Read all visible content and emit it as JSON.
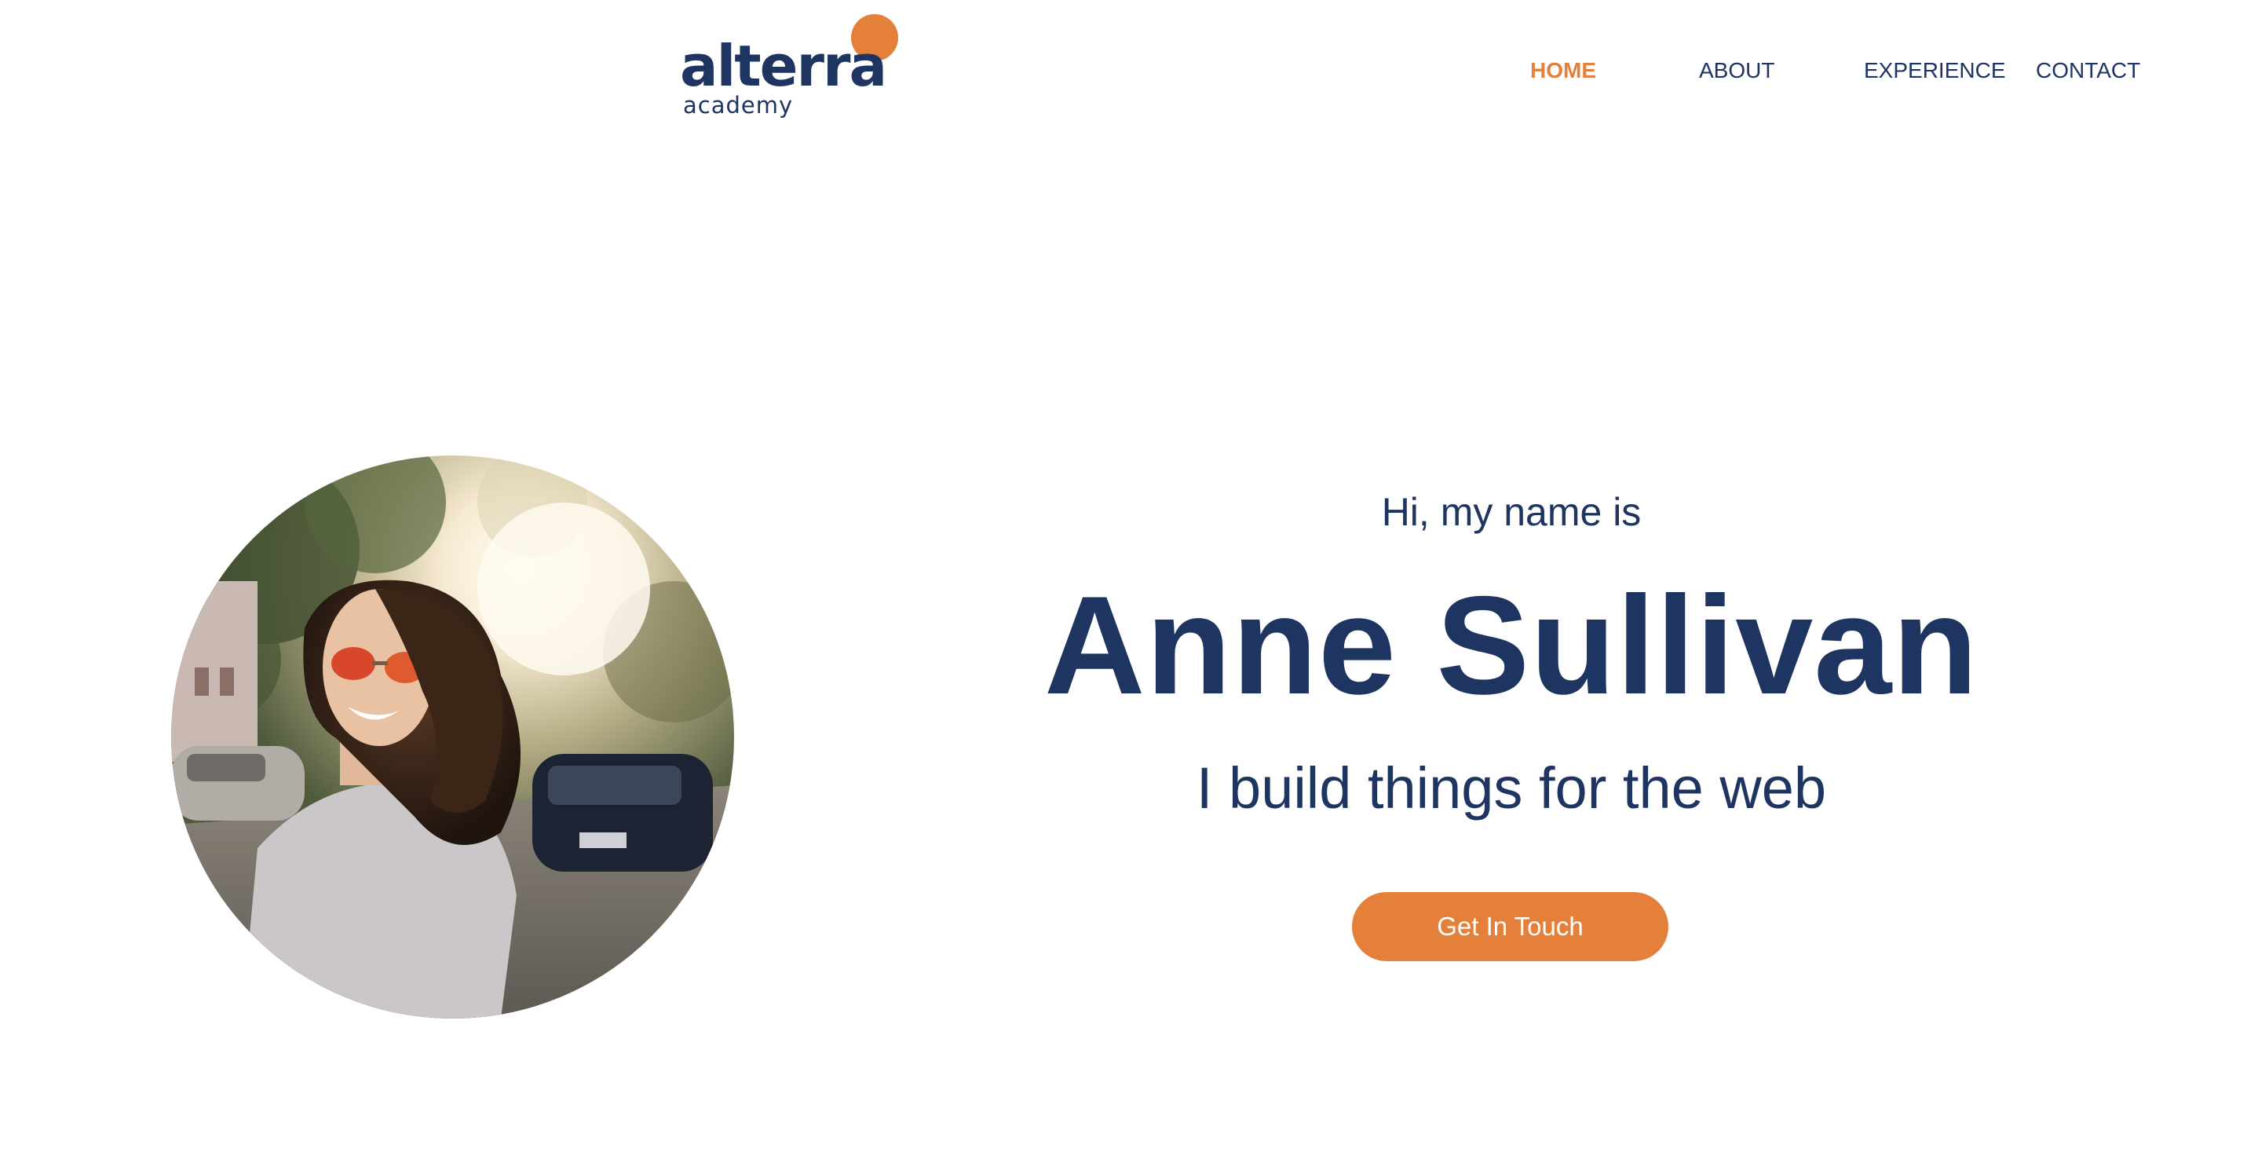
{
  "brand": {
    "name": "alterra",
    "subtitle": "academy",
    "colors": {
      "navy": "#1e3461",
      "orange": "#e5803b"
    }
  },
  "nav": {
    "items": [
      {
        "label": "HOME",
        "active": true
      },
      {
        "label": "ABOUT",
        "active": false
      },
      {
        "label": "EXPERIENCE",
        "active": false
      },
      {
        "label": "CONTACT",
        "active": false
      }
    ]
  },
  "hero": {
    "greeting": "Hi, my name is",
    "name": "Anne Sullivan",
    "tagline": "I build things for the web",
    "cta_label": "Get In Touch",
    "photo_icon": "profile-photo"
  }
}
